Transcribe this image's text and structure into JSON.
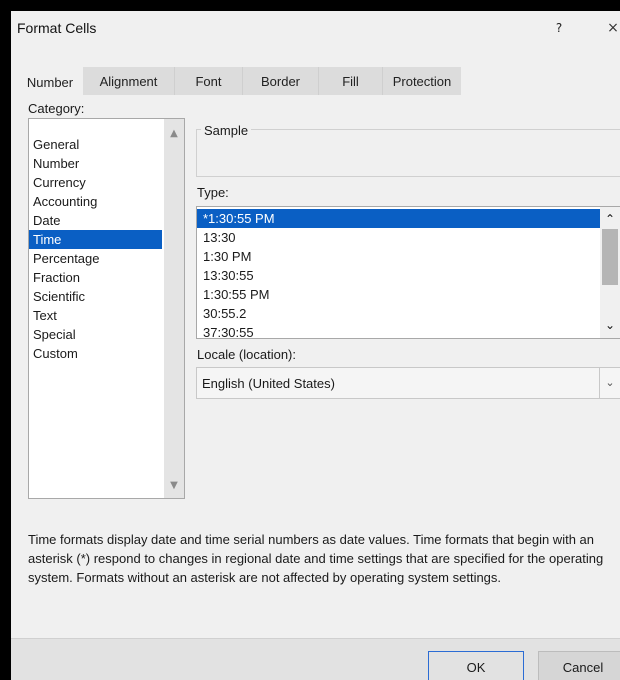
{
  "window": {
    "title": "Format Cells",
    "help_label": "?",
    "close_label": "×"
  },
  "tabs": [
    {
      "label": "Number",
      "active": true
    },
    {
      "label": "Alignment",
      "active": false
    },
    {
      "label": "Font",
      "active": false
    },
    {
      "label": "Border",
      "active": false
    },
    {
      "label": "Fill",
      "active": false
    },
    {
      "label": "Protection",
      "active": false
    }
  ],
  "category": {
    "label": "Category:",
    "items": [
      "General",
      "Number",
      "Currency",
      "Accounting",
      "Date",
      "Time",
      "Percentage",
      "Fraction",
      "Scientific",
      "Text",
      "Special",
      "Custom"
    ],
    "selected": "Time"
  },
  "sample": {
    "label": "Sample",
    "value": ""
  },
  "type": {
    "label": "Type:",
    "items": [
      "*1:30:55 PM",
      "13:30",
      "1:30 PM",
      "13:30:55",
      "1:30:55 PM",
      "30:55.2",
      "37:30:55"
    ],
    "selected": "*1:30:55 PM"
  },
  "locale": {
    "label": "Locale (location):",
    "value": "English (United States)"
  },
  "description": "Time formats display date and time serial numbers as date values.  Time formats that begin with an asterisk (*) respond to changes in regional date and time settings that are specified for the operating system. Formats without an asterisk are not affected by operating system settings.",
  "buttons": {
    "ok": "OK",
    "cancel": "Cancel"
  },
  "icons": {
    "scroll_up": "chevron-up-icon",
    "scroll_down": "chevron-down-icon",
    "dropdown": "chevron-down-icon"
  },
  "colors": {
    "selection": "#0a5fc4",
    "dialog_bg": "#f0f0f0",
    "ok_border": "#2b6cd4"
  }
}
